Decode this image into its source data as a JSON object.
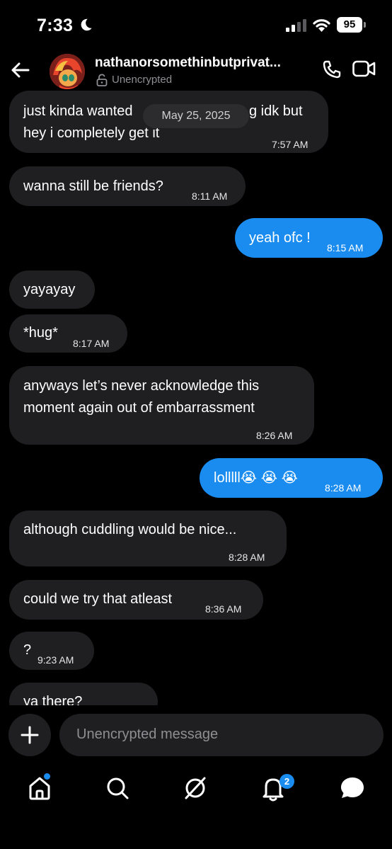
{
  "status_bar": {
    "time": "7:33",
    "battery": "95"
  },
  "header": {
    "contact_name": "nathanorsomethinbutprivat...",
    "encryption_label": "Unencrypted"
  },
  "date_separator": "May 25, 2025",
  "messages": [
    {
      "direction": "in",
      "line1": "just kinda wanted",
      "line1_tail": "g idk but",
      "line2": "hey i completely get it",
      "time": "7:57 AM"
    },
    {
      "direction": "in",
      "text": "wanna still be friends?",
      "time": "8:11 AM"
    },
    {
      "direction": "out",
      "text": "yeah ofc !",
      "time": "8:15 AM"
    },
    {
      "direction": "in",
      "text": "yayayay"
    },
    {
      "direction": "in",
      "text": "*hug*",
      "time": "8:17 AM"
    },
    {
      "direction": "in",
      "line1": "anyways let’s never acknowledge this",
      "line2": "moment again out of embarrassment",
      "time": "8:26 AM"
    },
    {
      "direction": "out",
      "text": "lolllll😭 😭 😭",
      "time": "8:28 AM"
    },
    {
      "direction": "in",
      "text": "although cuddling would be nice...",
      "time": "8:28 AM"
    },
    {
      "direction": "in",
      "text": "could we try that atleast",
      "time": "8:36 AM"
    },
    {
      "direction": "in",
      "text": "?",
      "time": "9:23 AM"
    },
    {
      "direction": "in",
      "text": "ya there?"
    }
  ],
  "composer": {
    "placeholder": "Unencrypted message"
  },
  "nav": {
    "notifications_badge": "2"
  },
  "colors": {
    "accent": "#1a8cf0",
    "incoming_bubble": "#1f1f21",
    "background": "#000000"
  },
  "icons": [
    "moon-icon",
    "signal-icon",
    "wifi-icon",
    "battery-icon",
    "back-arrow-icon",
    "lock-icon",
    "phone-icon",
    "video-icon",
    "plus-icon",
    "home-icon",
    "search-icon",
    "explore-icon",
    "bell-icon",
    "chat-icon"
  ]
}
